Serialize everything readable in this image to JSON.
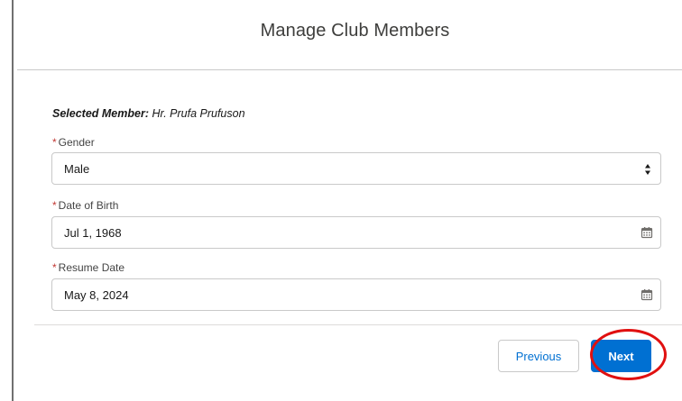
{
  "modal": {
    "title": "Manage Club Members"
  },
  "selected_member": {
    "label": "Selected Member:",
    "value": "Hr. Prufa Prufuson"
  },
  "fields": {
    "gender": {
      "required_marker": "*",
      "label": "Gender",
      "value": "Male"
    },
    "date_of_birth": {
      "required_marker": "*",
      "label": "Date of Birth",
      "value": "Jul 1, 1968"
    },
    "resume_date": {
      "required_marker": "*",
      "label": "Resume Date",
      "value": "May 8, 2024"
    }
  },
  "footer": {
    "previous_label": "Previous",
    "next_label": "Next"
  },
  "icons": {
    "select": "chevron-up-down-icon",
    "date": "calendar-icon"
  },
  "colors": {
    "brand_blue": "#0070d2",
    "required_red": "#c23934",
    "highlight_red": "#e01010",
    "border_gray": "#c9c9c9"
  }
}
